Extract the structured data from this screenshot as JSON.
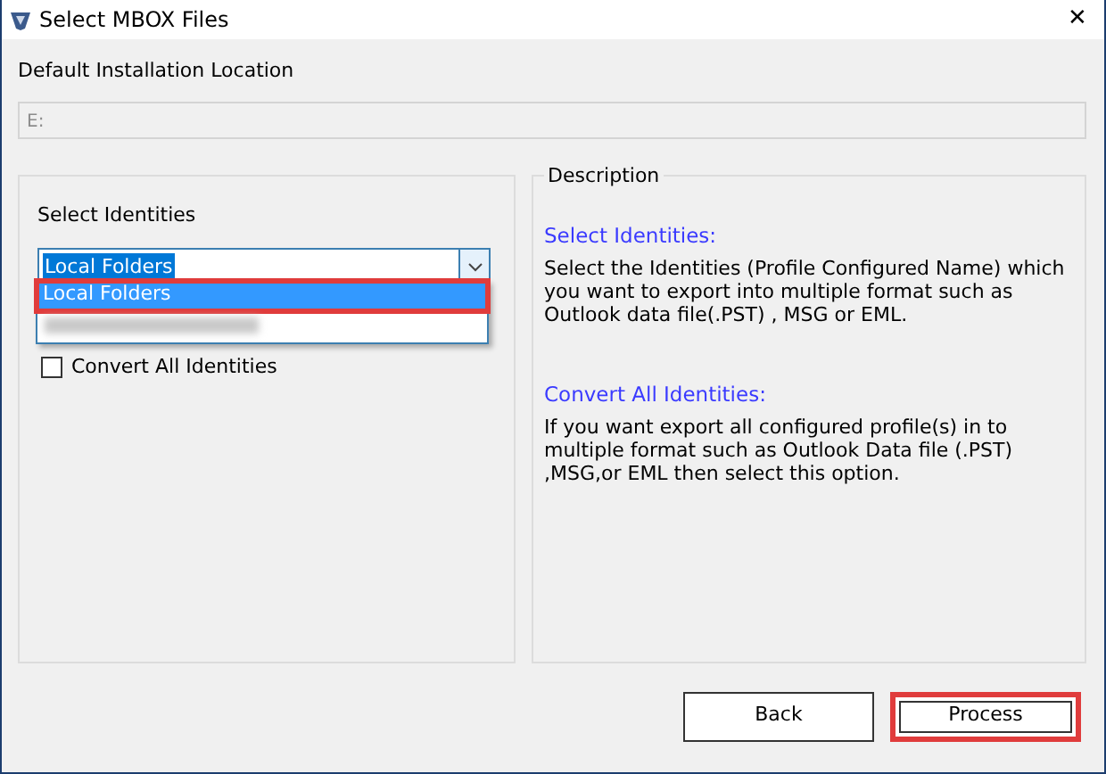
{
  "window": {
    "title": "Select MBOX Files",
    "close": "✕"
  },
  "install_location": {
    "label": "Default Installation Location",
    "value": "E:",
    "disabled": true
  },
  "identities": {
    "label": "Select Identities",
    "value": "Local Folders",
    "options": [
      {
        "label": "Local Folders",
        "selected": true,
        "highlighted": true
      },
      {
        "kind": "redacted",
        "selected": false,
        "highlighted": false
      }
    ],
    "convert_all": {
      "label": "Convert All Identities",
      "checked": false
    }
  },
  "description": {
    "legend": "Description",
    "sections": [
      {
        "heading": "Select Identities:",
        "text": "Select the Identities (Profile Configured Name) which you want to export into multiple format such as Outlook data file(.PST) , MSG or EML."
      },
      {
        "heading": "Convert All Identities:",
        "text": "If you want export all configured profile(s) in to multiple format such as Outlook Data file (.PST) ,MSG,or EML then select this option."
      }
    ]
  },
  "buttons": [
    {
      "label": "Back",
      "highlighted": false
    },
    {
      "label": "Process",
      "highlighted": true
    }
  ]
}
